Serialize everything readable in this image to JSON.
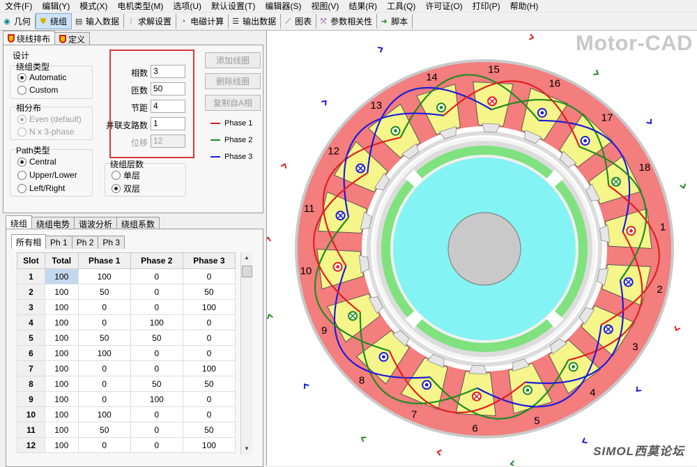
{
  "menu": [
    "文件(F)",
    "编辑(Y)",
    "模式(X)",
    "电机类型(M)",
    "选项(U)",
    "默认设置(T)",
    "编辑器(S)",
    "视图(V)",
    "结果(R)",
    "工具(Q)",
    "许可证(O)",
    "打印(P)",
    "帮助(H)"
  ],
  "toolbar": [
    {
      "label": "几何",
      "icon": "geometry-icon"
    },
    {
      "label": "绕组",
      "icon": "winding-icon"
    },
    {
      "label": "输入数据",
      "icon": "input-data-icon"
    },
    {
      "label": "求解设置",
      "icon": "solver-settings-icon"
    },
    {
      "label": "电磁计算",
      "icon": "em-calc-icon"
    },
    {
      "label": "输出数据",
      "icon": "output-data-icon"
    },
    {
      "label": "图表",
      "icon": "graph-icon"
    },
    {
      "label": "参数相关性",
      "icon": "parametric-icon"
    },
    {
      "label": "脚本",
      "icon": "script-icon"
    }
  ],
  "top_tabs": [
    "绕线排布",
    "定义"
  ],
  "design": {
    "group_label": "设计",
    "winding_type_label": "绕组类型",
    "winding_type_options": [
      "Automatic",
      "Custom"
    ],
    "phase_dist_label": "相分布",
    "phase_dist_options": [
      "Even (default)",
      "N x 3-phase"
    ],
    "path_type_label": "Path类型",
    "path_type_options": [
      "Central",
      "Upper/Lower",
      "Left/Right"
    ],
    "layers_label": "绕组层数",
    "layers_options": [
      "单层",
      "双层"
    ]
  },
  "fields": {
    "phases": {
      "label": "相数",
      "value": "3"
    },
    "turns": {
      "label": "匝数",
      "value": "50"
    },
    "pitch": {
      "label": "节距",
      "value": "4"
    },
    "parallel_paths": {
      "label": "并联支路数",
      "value": "1"
    },
    "offset": {
      "label": "位移",
      "value": "12"
    }
  },
  "buttons": {
    "add_coil": "添加线圈",
    "remove_coil": "删除线圈",
    "copy_from_a": "复制自A相"
  },
  "legend": [
    {
      "name": "Phase 1",
      "color": "#e02020"
    },
    {
      "name": "Phase 2",
      "color": "#1e8c1e"
    },
    {
      "name": "Phase 3",
      "color": "#1c1cd8"
    }
  ],
  "lower_tabs": [
    "绕组",
    "绕组电势",
    "谐波分析",
    "绕组系数"
  ],
  "phase_tabs": [
    "所有相",
    "Ph 1",
    "Ph 2",
    "Ph 3"
  ],
  "table": {
    "headers": [
      "Slot",
      "Total",
      "Phase 1",
      "Phase 2",
      "Phase 3"
    ],
    "rows": [
      [
        "1",
        "100",
        "100",
        "0",
        "0"
      ],
      [
        "2",
        "100",
        "50",
        "0",
        "50"
      ],
      [
        "3",
        "100",
        "0",
        "0",
        "100"
      ],
      [
        "4",
        "100",
        "0",
        "100",
        "0"
      ],
      [
        "5",
        "100",
        "50",
        "50",
        "0"
      ],
      [
        "6",
        "100",
        "100",
        "0",
        "0"
      ],
      [
        "7",
        "100",
        "0",
        "0",
        "100"
      ],
      [
        "8",
        "100",
        "0",
        "50",
        "50"
      ],
      [
        "9",
        "100",
        "0",
        "100",
        "0"
      ],
      [
        "10",
        "100",
        "100",
        "0",
        "0"
      ],
      [
        "11",
        "100",
        "50",
        "0",
        "50"
      ],
      [
        "12",
        "100",
        "0",
        "0",
        "100"
      ]
    ]
  },
  "brand": "Motor-CAD",
  "watermark": "SIMOL西莫论坛",
  "slot_labels": [
    "1",
    "2",
    "3",
    "4",
    "5",
    "6",
    "7",
    "8",
    "9",
    "10",
    "11",
    "12",
    "13",
    "14",
    "15",
    "16",
    "17",
    "18"
  ],
  "slot_conductors": [
    {
      "phase": 1,
      "dir": "out"
    },
    {
      "phase": 3,
      "dir": "in"
    },
    {
      "phase": 3,
      "dir": "in"
    },
    {
      "phase": 2,
      "dir": "out"
    },
    {
      "phase": 2,
      "dir": "out"
    },
    {
      "phase": 1,
      "dir": "in"
    },
    {
      "phase": 3,
      "dir": "out"
    },
    {
      "phase": 3,
      "dir": "out"
    },
    {
      "phase": 2,
      "dir": "in"
    },
    {
      "phase": 1,
      "dir": "out"
    },
    {
      "phase": 3,
      "dir": "in"
    },
    {
      "phase": 3,
      "dir": "in"
    },
    {
      "phase": 2,
      "dir": "out"
    },
    {
      "phase": 2,
      "dir": "out"
    },
    {
      "phase": 1,
      "dir": "in"
    },
    {
      "phase": 3,
      "dir": "out"
    },
    {
      "phase": 3,
      "dir": "out"
    },
    {
      "phase": 2,
      "dir": "in"
    }
  ]
}
